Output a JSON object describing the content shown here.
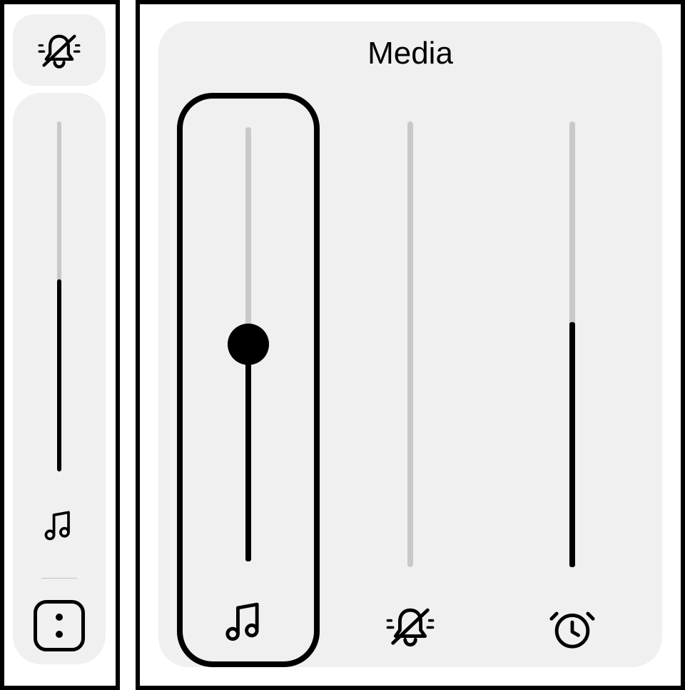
{
  "panel": {
    "title": "Media"
  },
  "colors": {
    "bg": "#f0f0f0",
    "fg": "#000000",
    "muted": "#c9c9c9"
  },
  "icons": {
    "bell_muted": "bell-muted-icon",
    "music": "music-icon",
    "alarm": "alarm-icon",
    "more": "more-icon"
  },
  "left": {
    "mute_active": true,
    "slider": {
      "value": 55
    }
  },
  "sliders": [
    {
      "name": "media",
      "icon": "music-icon",
      "value": 50,
      "showThumb": true,
      "selected": true
    },
    {
      "name": "notification",
      "icon": "bell-muted-icon",
      "value": 0,
      "showThumb": false,
      "selected": false
    },
    {
      "name": "alarm",
      "icon": "alarm-icon",
      "value": 55,
      "showThumb": false,
      "selected": false
    }
  ]
}
